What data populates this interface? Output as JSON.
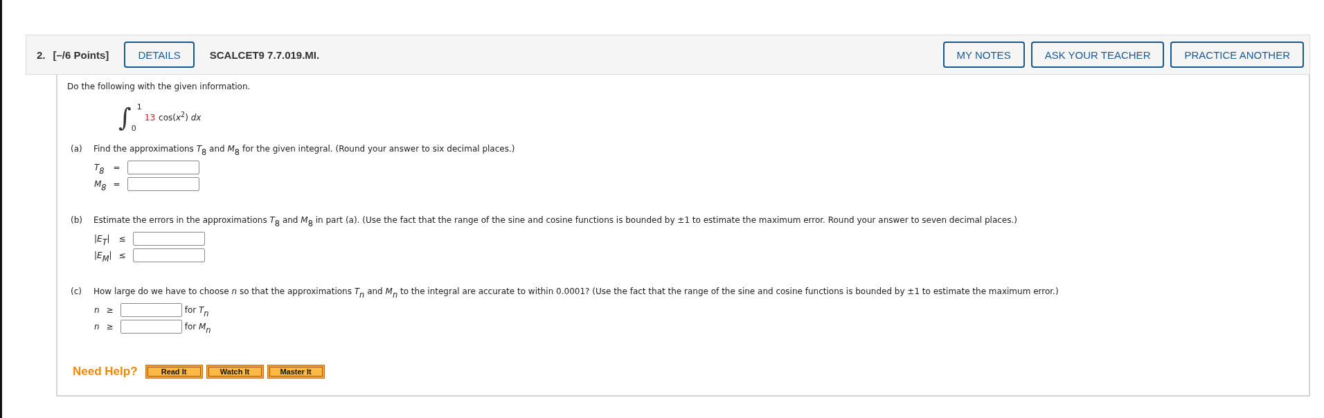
{
  "header": {
    "number": "2.",
    "points": "[–/6 Points]",
    "details": "DETAILS",
    "code": "SCALCET9 7.7.019.MI.",
    "actions": [
      "MY NOTES",
      "ASK YOUR TEACHER",
      "PRACTICE ANOTHER"
    ]
  },
  "intro": "Do the following with the given information.",
  "integral": {
    "sign": "∫",
    "upper": "1",
    "lower": "0",
    "coefficient": "13",
    "integrand": "cos(*x*$^{2}$) *dx*"
  },
  "parts": [
    {
      "label": "(a)",
      "prompt": "Find the approximations *T*$_{8}$ and *M*$_{8}$ for the given integral. (Round your answer to six decimal places.)",
      "answers": [
        {
          "label": "T$_{8}$",
          "relation": "="
        },
        {
          "label": "M$_{8}$",
          "relation": "="
        }
      ]
    },
    {
      "label": "(b)",
      "prompt": "Estimate the errors in the approximations *T*$_{8}$ and *M*$_{8}$ in part (a). (Use the fact that the range of the sine and cosine functions is bounded by ±1 to estimate the maximum error. Round your answer to seven decimal places.)",
      "answers": [
        {
          "label": "|E$_{T}$|",
          "relation": "≤"
        },
        {
          "label": "|E$_{M}$|",
          "relation": "≤"
        }
      ]
    },
    {
      "label": "(c)",
      "prompt": "How large do we have to choose *n* so that the approximations *T$_{n}$* and *M$_{n}$* to the integral are accurate to within 0.0001? (Use the fact that the range of the sine and cosine functions is bounded by ±1 to estimate the maximum error.)",
      "answers": [
        {
          "label": "n",
          "relation": "≥",
          "suffix": "for *T$_{n}$*"
        },
        {
          "label": "n",
          "relation": "≥",
          "suffix": "for *M$_{n}$*"
        }
      ]
    }
  ],
  "help": {
    "label": "Need Help?",
    "buttons": [
      "Read It",
      "Watch It",
      "Master It"
    ]
  }
}
